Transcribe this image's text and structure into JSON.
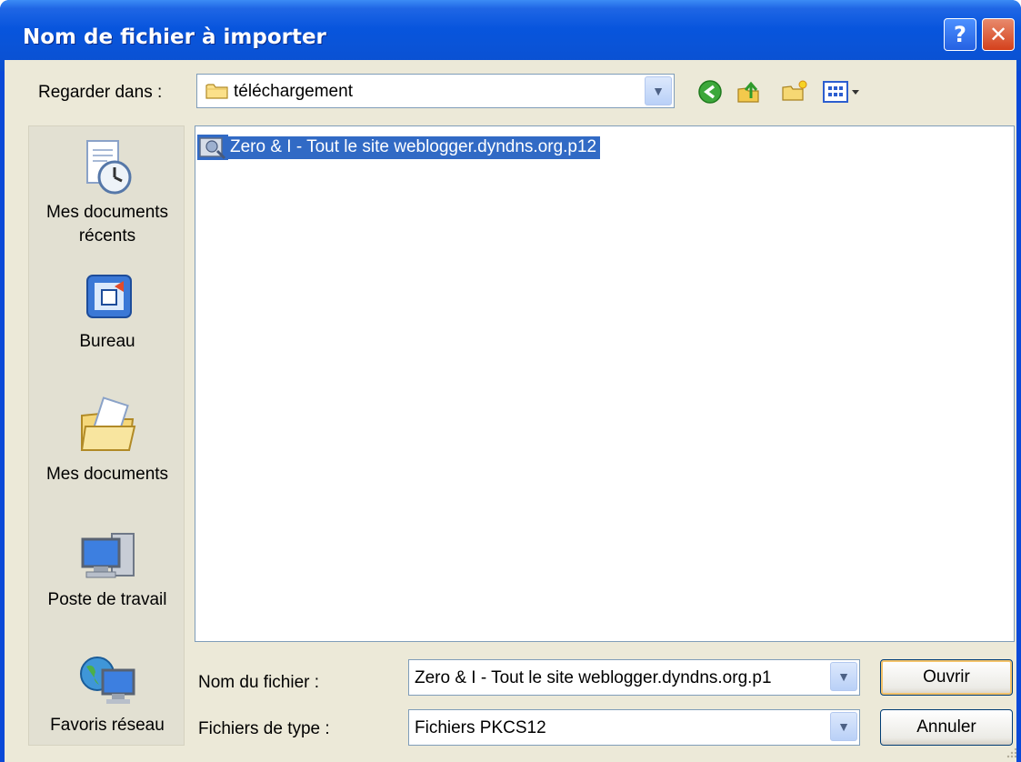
{
  "window": {
    "title": "Nom de fichier à importer",
    "help_label": "?",
    "close_label": "✕"
  },
  "look_in": {
    "label": "Regarder dans :",
    "value": "téléchargement"
  },
  "toolbar": {
    "icons": [
      "back-icon",
      "up-folder-icon",
      "new-folder-icon",
      "view-menu-icon"
    ]
  },
  "places": {
    "recent": "Mes documents récents",
    "desktop": "Bureau",
    "documents": "Mes documents",
    "computer": "Poste de travail",
    "network": "Favoris réseau"
  },
  "files": [
    {
      "name": "Zero & I - Tout le site weblogger.dyndns.org.p12",
      "icon": "certificate-file-icon",
      "selected": true
    }
  ],
  "filename": {
    "label": "Nom du fichier :",
    "value": "Zero & I - Tout le site weblogger.dyndns.org.p1"
  },
  "filetype": {
    "label": "Fichiers de type :",
    "value": "Fichiers PKCS12"
  },
  "buttons": {
    "open": "Ouvrir",
    "cancel": "Annuler"
  },
  "colors": {
    "titlebar": "#0a53d6",
    "selection": "#316ac5",
    "dialog_bg": "#ece9d8"
  }
}
